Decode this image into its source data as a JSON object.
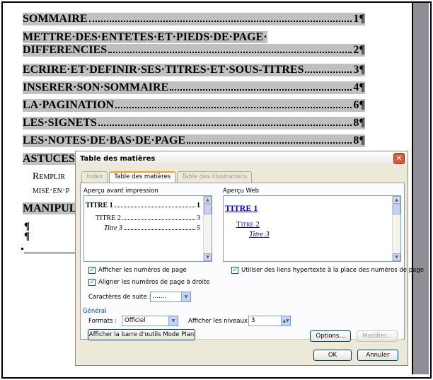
{
  "document": {
    "toc": [
      {
        "text": "SOMMAIRE",
        "page": "1¶"
      },
      {
        "text1": "METTRE·DES·ENTETES·ET·PIEDS·DE·PAGE·",
        "text2": "DIFFERENCIES",
        "page": "2¶"
      },
      {
        "text": "ECRIRE·ET·DEFINIR·SES·TITRES·ET·SOUS-TITRES",
        "page": "3¶"
      },
      {
        "text": "INSERER·SON·SOMMAIRE",
        "page": "4¶"
      },
      {
        "text": "LA·PAGINATION",
        "page": "6¶"
      },
      {
        "text": "LES·SIGNETS",
        "page": "8¶"
      },
      {
        "text": "LES·NOTES·DE·BAS·DE·PAGE",
        "page": "8¶"
      },
      {
        "text": "ASTUCES"
      }
    ],
    "sub_line1": "Remplir",
    "sub_line2": "mise·en·p",
    "manip": "MANIPUL",
    "pilcrow": "¶"
  },
  "dialog": {
    "title": "Table des matières",
    "tabs": [
      "Index",
      "Table des matières",
      "Table des illustrations"
    ],
    "print_preview_label": "Aperçu avant impression",
    "web_preview_label": "Aperçu Web",
    "print_preview": {
      "l1": {
        "text": "TITRE 1",
        "page": "1"
      },
      "l2": {
        "text": "TITRE 2",
        "page": "3"
      },
      "l3": {
        "text": "Titre 3",
        "page": "5"
      }
    },
    "web_preview": {
      "l1": "TITRE 1",
      "l2": "Titre 2",
      "l3": "Titre 3"
    },
    "show_page_numbers": "Afficher les numéros de page",
    "align_right": "Aligner les numéros de page à droite",
    "leader_label": "Caractères de suite :",
    "leader_value": ".......",
    "use_hyperlinks": "Utiliser des liens hypertexte à la place des numéros de page",
    "general_label": "Général",
    "formats_label": "Formats :",
    "formats_value": "Officiel",
    "levels_label": "Afficher les niveaux :",
    "levels_value": "3",
    "outline_button": "Afficher la barre d'outils Mode Plan",
    "options_button": "Options...",
    "modify_button": "Modifier...",
    "ok_button": "OK",
    "cancel_button": "Annuler",
    "check_mark": "✓",
    "close_glyph": "✕"
  },
  "colors": {
    "highlight": "#c0c0c0",
    "hyperlink": "#0000cc",
    "dialog_bg": "#ece9d8",
    "close": "#d85a3e"
  }
}
